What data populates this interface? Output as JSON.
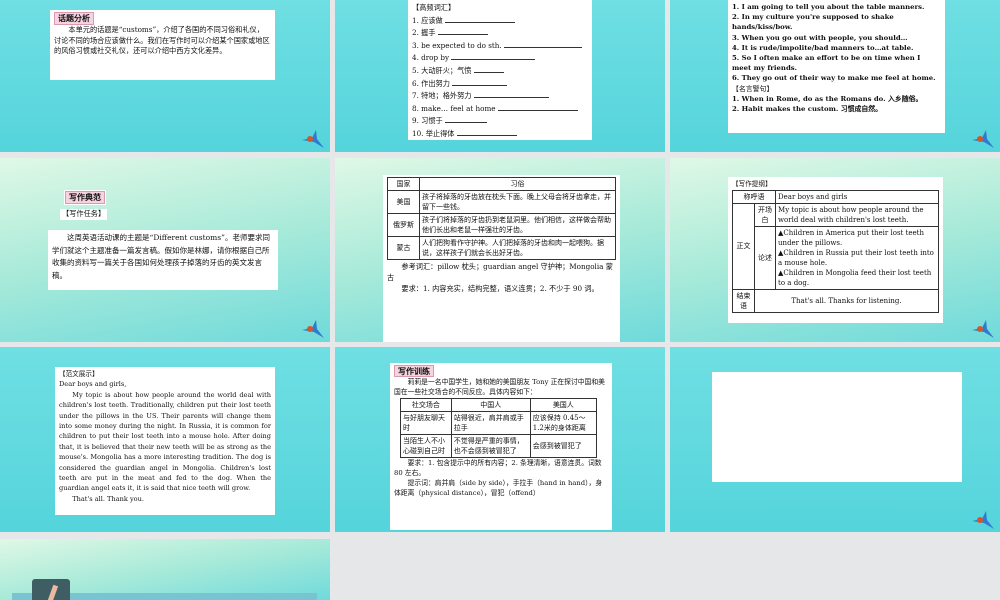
{
  "slides": [
    {
      "tag": "话题分析",
      "text": "本单元的话题是“customs”，介绍了各国的不同习俗和礼仪，讨论不同的场合应该做什么。我们在写作时可以介绍某个国家或地区的风俗习惯或社交礼仪，还可以介绍中西方文化差异。"
    },
    {
      "heading": "【高频词汇】",
      "items": [
        "1. 应该做",
        "2. 握手",
        "3. be expected to do sth.",
        "4. drop by",
        "5. 大动肝火；气愤",
        "6. 作出努力",
        "7. 特地；格外努力",
        "8. make… feel at home",
        "9. 习惯于",
        "10. 举止得体"
      ]
    },
    {
      "items": [
        "1. I am going to tell you about the table manners.",
        "2. In my culture you're supposed to shake hands/kiss/bow.",
        "3. When you go out with people, you should…",
        "4. It is rude/impolite/bad manners to…at table.",
        "5. So I often make an effort to be on time when I meet my friends.",
        "6. They go out of their way to make me feel at home."
      ],
      "heading2": "【名言警句】",
      "quotes": [
        "1. When in Rome, do as the Romans do. 入乡随俗。",
        "2. Habit makes the custom. 习惯成自然。"
      ]
    },
    {
      "tag": "写作典范",
      "subheading": "【写作任务】",
      "text": "这周英语活动课的主题是“Different customs”。老师要求同学们就这个主题准备一篇发言稿。假如你是林娜，请你根据自己所收集的资料写一篇关于各国如何处理孩子掉落的牙齿的英文发言稿。"
    },
    {
      "table": {
        "headers": [
          "国家",
          "习俗"
        ],
        "rows": [
          [
            "美国",
            "孩子将掉落的牙齿放在枕头下面。晚上父母会将牙齿拿走，并留下一些钱。"
          ],
          [
            "俄罗斯",
            "孩子们将掉落的牙齿扔到老鼠洞里。他们相信，这样做会帮助他们长出和老鼠一样强壮的牙齿。"
          ],
          [
            "蒙古",
            "人们把狗看作守护神。人们把掉落的牙齿和肉一起喂狗。据说，这样孩子们就会长出好牙齿。"
          ]
        ]
      },
      "vocab": "参考词汇：pillow 枕头；guardian angel 守护神；Mongolia 蒙古",
      "req": "要求：1. 内容充实，结构完整，语义连贯；2. 不少于 90 词。"
    },
    {
      "heading": "【写作提纲】",
      "r1": [
        "称呼语",
        "Dear boys and girls"
      ],
      "body_label": "正文",
      "r2": [
        "开场白",
        "My topic is about how people around the world deal with children's lost teeth."
      ],
      "r3label": "论述",
      "points": [
        "▲Children in America put their lost teeth under the pillows.",
        "▲Children in Russia put their lost teeth into a mouse hole.",
        "▲Children in Mongolia feed their lost teeth to a dog."
      ],
      "r4": [
        "结束语",
        "That's all. Thanks for listening."
      ]
    },
    {
      "heading": "【范文展示】",
      "greet": "Dear boys and girls,",
      "body": "My topic is about how people around the world deal with children's lost teeth. Traditionally, children put their lost teeth under the pillows in the US. Their parents will change them into some money during the night. In Russia, it is common for children to put their lost teeth into a mouse hole. After doing that, it is believed that their new teeth will be as strong as the mouse's. Mongolia has a more interesting tradition. The dog is considered the guardian angel in Mongolia. Children's lost teeth are put in the meat and fed to the dog. When the guardian angel eats it, it is said that nice teeth will grow.",
      "close": "That's all. Thank you."
    },
    {
      "tag": "写作训练",
      "intro": "莉莉是一名中国学生，她和她的美国朋友 Tony 正在探讨中国和美国在一些社交场合的不同反应。具体内容如下：",
      "table": {
        "headers": [
          "社交场合",
          "中国人",
          "美国人"
        ],
        "rows": [
          [
            "与好朋友聊天时",
            "站得很近，肩并肩或手拉手",
            "应该保持 0.45～1.2米的身体距离"
          ],
          [
            "当陌生人不小心碰到自己时",
            "不觉得是严重的事情，也不会感到被冒犯了",
            "会感到被冒犯了"
          ]
        ]
      },
      "req": "要求：1. 包含提示中的所有内容；2. 条理清晰，语意连贯。词数 80 左右。",
      "hint": "提示词：肩并肩（side by side），手拉手（hand in hand），身体距离（physical distance），冒犯（offend）"
    }
  ]
}
